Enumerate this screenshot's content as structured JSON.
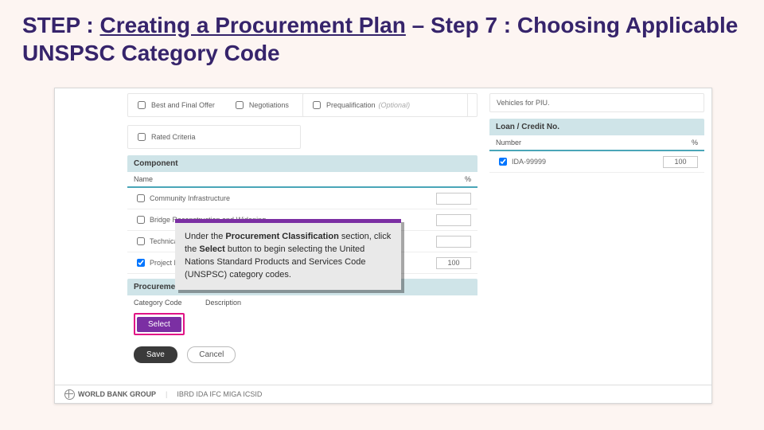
{
  "title": {
    "pre": "STEP : ",
    "link": "Creating a Procurement Plan",
    "post": " – Step 7 : Choosing Applicable UNSPSC Category Code"
  },
  "options": {
    "box1": [
      "Best and Final Offer",
      "Negotiations"
    ],
    "box2": [
      "Prequalification"
    ],
    "box2_note": "(Optional)",
    "rated": "Rated Criteria",
    "right_note": "Vehicles for PIU."
  },
  "component": {
    "header": "Component",
    "cols": [
      "Name",
      "%"
    ],
    "rows": [
      {
        "name": "Community Infrastructure",
        "checked": false,
        "pct": ""
      },
      {
        "name": "Bridge Reconstruction and Widening",
        "checked": false,
        "pct": ""
      },
      {
        "name": "Technical Assistance",
        "checked": false,
        "pct": ""
      },
      {
        "name": "Project Management",
        "checked": true,
        "pct": "100"
      }
    ]
  },
  "loan": {
    "header": "Loan / Credit No.",
    "cols": [
      "Number",
      "%"
    ],
    "rows": [
      {
        "name": "IDA-99999",
        "checked": true,
        "pct": "100"
      }
    ]
  },
  "pc": {
    "header": "Procurement Classification",
    "cols": [
      "Category Code",
      "Description"
    ],
    "select": "Select"
  },
  "buttons": {
    "save": "Save",
    "cancel": "Cancel"
  },
  "footer": {
    "group": "WORLD BANK GROUP",
    "orgs": "IBRD   IDA   IFC   MIGA   ICSID"
  },
  "tooltip": {
    "l1a": "Under the ",
    "l1b": "Procurement Classification",
    "l2a": " section, click the ",
    "l2b": "Select",
    "l2c": " button to begin selecting the United Nations Standard Products and Services Code (UNSPSC) category codes."
  }
}
